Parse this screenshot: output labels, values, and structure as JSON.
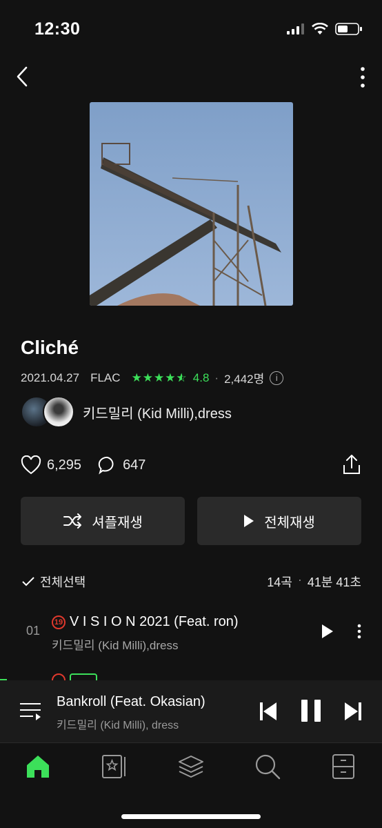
{
  "status": {
    "time": "12:30"
  },
  "album": {
    "title": "Cliché",
    "date": "2021.04.27",
    "format": "FLAC",
    "rating": "4.8",
    "rating_count": "2,442명",
    "rating_stars": 4.5,
    "artist": "키드밀리 (Kid Milli),dress"
  },
  "social": {
    "likes": "6,295",
    "comments": "647"
  },
  "actions": {
    "shuffle_label": "셔플재생",
    "play_all_label": "전체재생"
  },
  "list": {
    "select_all": "전체선택",
    "track_count": "14곡",
    "duration": "41분 41초"
  },
  "tracks": [
    {
      "num": "01",
      "age_badge": "19",
      "title": "V I S I O N 2021 (Feat. ron)",
      "artist": "키드밀리 (Kid Milli),dress"
    }
  ],
  "now_playing": {
    "title": "Bankroll (Feat. Okasian)",
    "artist": "키드밀리 (Kid Milli), dress"
  },
  "tabs": [
    "home-icon",
    "library-icon",
    "layers-icon",
    "search-icon",
    "storage-icon"
  ],
  "colors": {
    "accent": "#3ce05a",
    "background": "#121212",
    "button": "#2a2a2a",
    "age_badge": "#e0392d"
  }
}
